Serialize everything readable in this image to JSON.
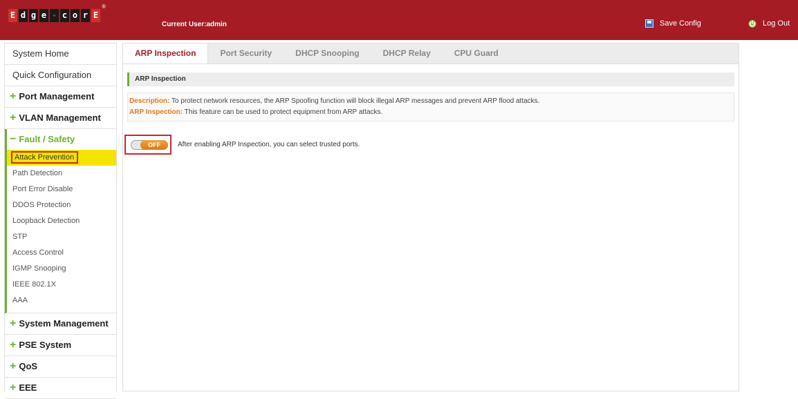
{
  "header": {
    "logo": {
      "chars": [
        "E",
        "d",
        "g",
        "e",
        "-",
        "c",
        "o",
        "r",
        "E"
      ],
      "reg_mark": "®"
    },
    "current_user": "Current User:admin",
    "save_config": "Save Config",
    "logout": "Log Out",
    "colors": {
      "background": "#a51c24"
    }
  },
  "sidebar": {
    "system_home": "System Home",
    "quick_configuration": "Quick Configuration",
    "groups_before": [
      {
        "label": "Port Management",
        "icon": "+"
      },
      {
        "label": "VLAN Management",
        "icon": "+"
      }
    ],
    "open_group": {
      "label": "Fault / Safety",
      "icon": "−"
    },
    "sub_items": [
      {
        "label": "Attack Prevention",
        "active": true
      },
      {
        "label": "Path Detection"
      },
      {
        "label": "Port Error Disable"
      },
      {
        "label": "DDOS Protection"
      },
      {
        "label": "Loopback Detection"
      },
      {
        "label": "STP"
      },
      {
        "label": "Access Control"
      },
      {
        "label": "IGMP Snooping"
      },
      {
        "label": "IEEE 802.1X"
      },
      {
        "label": "AAA"
      }
    ],
    "groups_after": [
      {
        "label": "System Management",
        "icon": "+"
      },
      {
        "label": "PSE System",
        "icon": "+"
      },
      {
        "label": "QoS",
        "icon": "+"
      },
      {
        "label": "EEE",
        "icon": "+"
      }
    ],
    "colors": {
      "accent": "#6bb12e",
      "highlight": "#f5e400"
    }
  },
  "main": {
    "tabs": [
      {
        "label": "ARP Inspection",
        "active": true
      },
      {
        "label": "Port Security"
      },
      {
        "label": "DHCP Snooping"
      },
      {
        "label": "DHCP Relay"
      },
      {
        "label": "CPU Guard"
      }
    ],
    "section_title": "ARP Inspection",
    "description": {
      "key1": "Description:",
      "text1": " To protect network resources, the ARP Spoofing function will block illegal ARP messages and prevent ARP flood attacks.",
      "key2": "ARP Inspection:",
      "text2": " This feature can be used to protect equipment from ARP attacks."
    },
    "toggle": {
      "state": "OFF",
      "hint": "After enabling ARP Inspection, you can select trusted ports."
    },
    "colors": {
      "desc_key": "#e07a1a",
      "toggle": "#f2a33a",
      "highlight_border": "#c8262d"
    }
  }
}
